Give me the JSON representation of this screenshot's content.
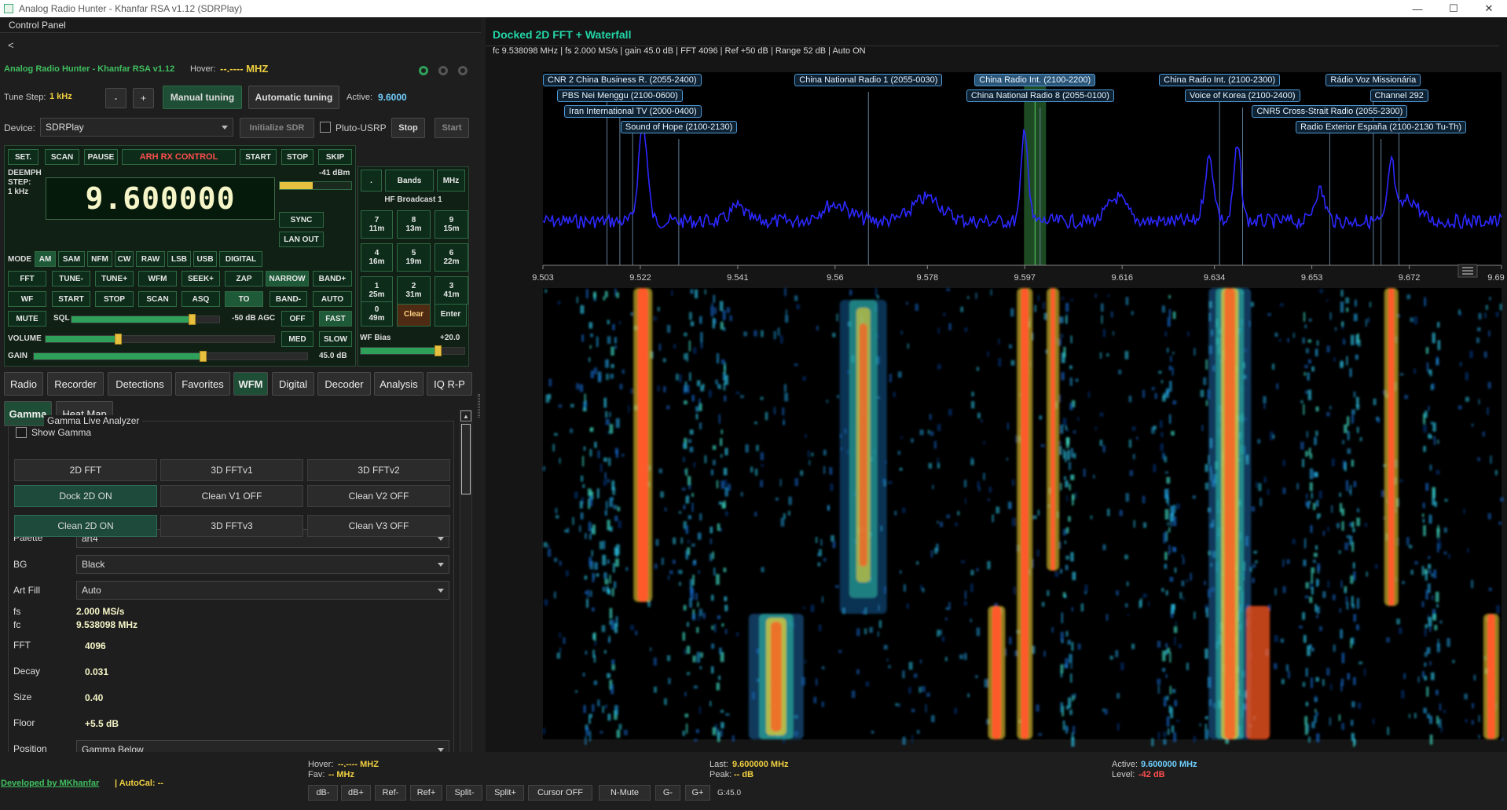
{
  "window": {
    "title": "Analog Radio Hunter - Khanfar RSA v1.12 (SDRPlay)",
    "min": "—",
    "max": "☐",
    "close": "✕"
  },
  "control_panel": {
    "title": "Control Panel",
    "back": "<",
    "app_name": "Analog Radio Hunter - Khanfar RSA v1.12",
    "hover_label": "Hover:",
    "hover_value": "--.---- MHZ",
    "tune_step_label": "Tune Step:",
    "tune_step_value": "1 kHz",
    "minus": "-",
    "plus": "+",
    "manual_tuning": "Manual tuning",
    "automatic_tuning": "Automatic tuning",
    "active_label": "Active:",
    "active_value": "9.6000",
    "device_label": "Device:",
    "device_value": "SDRPlay",
    "initialize_sdr": "Initialize SDR",
    "pluto": "Pluto-USRP",
    "stop": "Stop",
    "start": "Start"
  },
  "rx": {
    "set": "SET.",
    "scan": "SCAN",
    "pause": "PAUSE",
    "arh": "ARH RX CONTROL",
    "start": "START",
    "stop": "STOP",
    "skip": "SKIP",
    "dbm": "-41 dBm",
    "deemph": "DEEMPH",
    "step": "STEP:",
    "step_val": "1 kHz",
    "frequency": "9.600000",
    "sync": "SYNC",
    "lan_out": "LAN OUT",
    "mode_label": "MODE",
    "modes": [
      "AM",
      "SAM",
      "NFM",
      "CW",
      "RAW",
      "LSB",
      "USB",
      "DIGITAL"
    ],
    "row1": [
      "FFT",
      "TUNE-",
      "TUNE+",
      "WFM",
      "SEEK+",
      "ZAP",
      "NARROW",
      "BAND+"
    ],
    "row2": [
      "WF",
      "START",
      "STOP",
      "SCAN",
      "ASQ",
      "TO",
      "BAND-",
      "AUTO"
    ],
    "mute": "MUTE",
    "sql": "SQL",
    "agc": "-50 dB AGC",
    "off": "OFF",
    "fast": "FAST",
    "volume": "VOLUME",
    "med": "MED",
    "slow": "SLOW",
    "gain": "GAIN",
    "gain_val": "45.0 dB",
    "sql_level": 0.82,
    "volume_level": 0.32,
    "gain_level": 0.62
  },
  "keypad": {
    "dot": ".",
    "bands": "Bands",
    "mhz": "MHz",
    "band_name": "HF Broadcast 1",
    "keys": [
      {
        "d": "7",
        "m": "11m"
      },
      {
        "d": "8",
        "m": "13m"
      },
      {
        "d": "9",
        "m": "15m"
      },
      {
        "d": "4",
        "m": "16m"
      },
      {
        "d": "5",
        "m": "19m"
      },
      {
        "d": "6",
        "m": "22m"
      },
      {
        "d": "1",
        "m": "25m"
      },
      {
        "d": "2",
        "m": "31m"
      },
      {
        "d": "3",
        "m": "41m"
      },
      {
        "d": "0",
        "m": "49m"
      }
    ],
    "clear": "Clear",
    "enter": "Enter",
    "wf_bias": "WF Bias",
    "wf_bias_val": "+20.0",
    "wf_bias_level": 0.75
  },
  "tabs": [
    "Radio",
    "Recorder",
    "Detections",
    "Favorites",
    "WFM",
    "Digital",
    "Decoder",
    "Analysis",
    "IQ R-P"
  ],
  "subtabs": [
    "Gamma",
    "Heat Map"
  ],
  "gamma": {
    "group": "Gamma Live Analyzer",
    "show_gamma": "Show Gamma",
    "buttons": [
      {
        "t": "2D FFT",
        "on": false
      },
      {
        "t": "3D FFTv1",
        "on": false
      },
      {
        "t": "3D FFTv2",
        "on": false
      },
      {
        "t": "Dock 2D ON",
        "on": true
      },
      {
        "t": "Clean V1 OFF",
        "on": false
      },
      {
        "t": "Clean V2 OFF",
        "on": false
      },
      {
        "t": "Clean 2D ON",
        "on": true
      },
      {
        "t": "3D FFTv3",
        "on": false
      },
      {
        "t": "Clean V3 OFF",
        "on": false
      }
    ],
    "palette_label": "Palette",
    "palette": "art4",
    "bg_label": "BG",
    "bg": "Black",
    "artfill_label": "Art Fill",
    "artfill": "Auto",
    "fs_label": "fs",
    "fs": "2.000 MS/s",
    "fc_label": "fc",
    "fc": "9.538098 MHz",
    "fft_label": "FFT",
    "fft": "4096",
    "decay_label": "Decay",
    "decay": "0.031",
    "size_label": "Size",
    "size": "0.40",
    "floor_label": "Floor",
    "floor": "+5.5 dB",
    "position_label": "Position",
    "position": "Gamma Below"
  },
  "dock": {
    "title": "Docked 2D FFT + Waterfall",
    "info": "fc 9.538098 MHz | fs 2.000 MS/s | gain 45.0 dB | FFT 4096 | Ref +50 dB | Range 52 dB | Auto ON",
    "ticks": [
      "9.503",
      "9.522",
      "9.541",
      "9.56",
      "9.578",
      "9.597",
      "9.616",
      "9.634",
      "9.653",
      "9.672",
      "9.69"
    ],
    "stations": [
      {
        "t": "CNR 2 China Business R. (2055-2400)",
        "f": 9.5155,
        "row": 0
      },
      {
        "t": "China National Radio 1 (2055-0030)",
        "f": 9.5665,
        "row": 0
      },
      {
        "t": "China Radio Int. (2100-2200)",
        "f": 9.599,
        "row": 0,
        "sel": true
      },
      {
        "t": "China Radio Int. (2100-2300)",
        "f": 9.635,
        "row": 0
      },
      {
        "t": "Rádio Voz Missionária",
        "f": 9.665,
        "row": 0
      },
      {
        "t": "PBS Nei Menggu (2100-0600)",
        "f": 9.518,
        "row": 1
      },
      {
        "t": "China National Radio 8 (2055-0100)",
        "f": 9.6,
        "row": 1
      },
      {
        "t": "Voice of Korea (2100-2400)",
        "f": 9.6395,
        "row": 1
      },
      {
        "t": "Channel 292",
        "f": 9.67,
        "row": 1
      },
      {
        "t": "Iran International TV (2000-0400)",
        "f": 9.5205,
        "row": 2
      },
      {
        "t": "CNR5 Cross-Strait Radio (2055-2300)",
        "f": 9.6565,
        "row": 2
      },
      {
        "t": "Sound of Hope (2100-2130)",
        "f": 9.5295,
        "row": 3
      },
      {
        "t": "Radio Exterior España (2100-2130 Tu-Th)",
        "f": 9.6665,
        "row": 3
      }
    ]
  },
  "status": {
    "developed": "Developed by MKhanfar",
    "autocal": "| AutoCal: --",
    "hover_label": "Hover:",
    "hover_value": "--.---- MHZ",
    "fav_label": "Fav:",
    "fav_value": "-- MHz",
    "last_label": "Last:",
    "last_value": "9.600000 MHz",
    "peak_label": "Peak:",
    "peak_value": "-- dB",
    "active_label": "Active:",
    "active_value": "9.600000 MHz",
    "level_label": "Level:",
    "level_value": "-42 dB",
    "buttons": [
      "dB-",
      "dB+",
      "Ref-",
      "Ref+",
      "Split-",
      "Split+",
      "Cursor OFF",
      "N-Mute",
      "G-",
      "G+"
    ],
    "gval": "G:45.0"
  },
  "colors": {
    "accent_green": "#2fa05a",
    "yellow": "#f0d040",
    "cyan": "#6fd0ff",
    "red": "#ff4d4d",
    "fft_line": "#2c28ff"
  }
}
